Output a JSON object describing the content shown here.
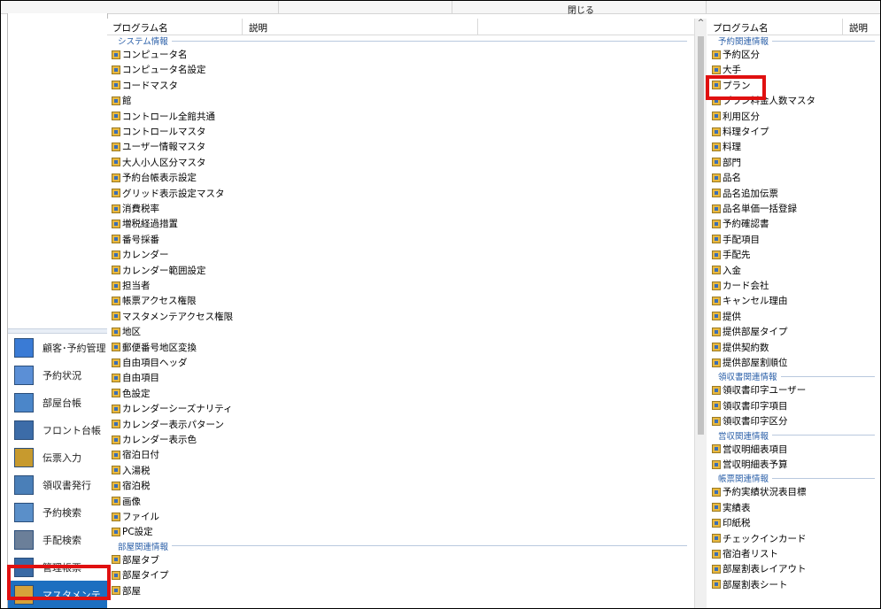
{
  "toolbar": {
    "close_label": "閉じる"
  },
  "nav": {
    "items": [
      {
        "label": "顧客･予約管理",
        "icon": "customer-icon",
        "active": false
      },
      {
        "label": "予約状況",
        "icon": "calendar-icon",
        "active": false
      },
      {
        "label": "部屋台帳",
        "icon": "room-ledger-icon",
        "active": false
      },
      {
        "label": "フロント台帳",
        "icon": "front-ledger-icon",
        "active": false
      },
      {
        "label": "伝票入力",
        "icon": "slip-icon",
        "active": false
      },
      {
        "label": "領収書発行",
        "icon": "receipt-icon",
        "active": false
      },
      {
        "label": "予約検索",
        "icon": "search-icon",
        "active": false
      },
      {
        "label": "手配検索",
        "icon": "arrange-icon",
        "active": false
      },
      {
        "label": "管理帳票",
        "icon": "report-icon",
        "active": false
      },
      {
        "label": "マスタメンテ",
        "icon": "master-icon",
        "active": true
      }
    ]
  },
  "left_panel": {
    "col_name": "プログラム名",
    "col_desc": "説明",
    "groups": [
      {
        "title": "システム情報",
        "items": [
          "コンピュータ名",
          "コンピュータ名設定",
          "コードマスタ",
          "館",
          "コントロール全館共通",
          "コントロールマスタ",
          "ユーザー情報マスタ",
          "大人小人区分マスタ",
          "予約台帳表示設定",
          "グリッド表示設定マスタ",
          "消費税率",
          "増税経過措置",
          "番号採番",
          "カレンダー",
          "カレンダー範囲設定",
          "担当者",
          "帳票アクセス権限",
          "マスタメンテアクセス権限",
          "地区",
          "郵便番号地区変換",
          "自由項目ヘッダ",
          "自由項目",
          "色設定",
          "カレンダーシーズナリティ",
          "カレンダー表示パターン",
          "カレンダー表示色",
          "宿泊日付",
          "入湯税",
          "宿泊税",
          "画像",
          "ファイル",
          "PC設定"
        ]
      },
      {
        "title": "部屋関連情報",
        "items": [
          "部屋タブ",
          "部屋タイプ",
          "部屋"
        ]
      }
    ]
  },
  "right_panel": {
    "col_name": "プログラム名",
    "col_desc": "説明",
    "groups": [
      {
        "title": "予約関連情報",
        "items": [
          "予約区分",
          "大手",
          "プラン",
          "プラン料金人数マスタ",
          "利用区分",
          "料理タイプ",
          "料理",
          "部門",
          "品名",
          "品名追加伝票",
          "品名単価一括登録",
          "予約確認書",
          "手配項目",
          "手配先",
          "入金",
          "カード会社",
          "キャンセル理由",
          "提供",
          "提供部屋タイプ",
          "提供契約数",
          "提供部屋割順位"
        ]
      },
      {
        "title": "領収書関連情報",
        "items": [
          "領収書印字ユーザー",
          "領収書印字項目",
          "領収書印字区分"
        ]
      },
      {
        "title": "営収関連情報",
        "items": [
          "営収明細表項目",
          "営収明細表予算"
        ]
      },
      {
        "title": "帳票関連情報",
        "items": [
          "予約実績状況表目標",
          "実績表",
          "印紙税",
          "チェックインカード",
          "宿泊者リスト",
          "部屋割表レイアウト",
          "部屋割表シート"
        ]
      }
    ]
  }
}
